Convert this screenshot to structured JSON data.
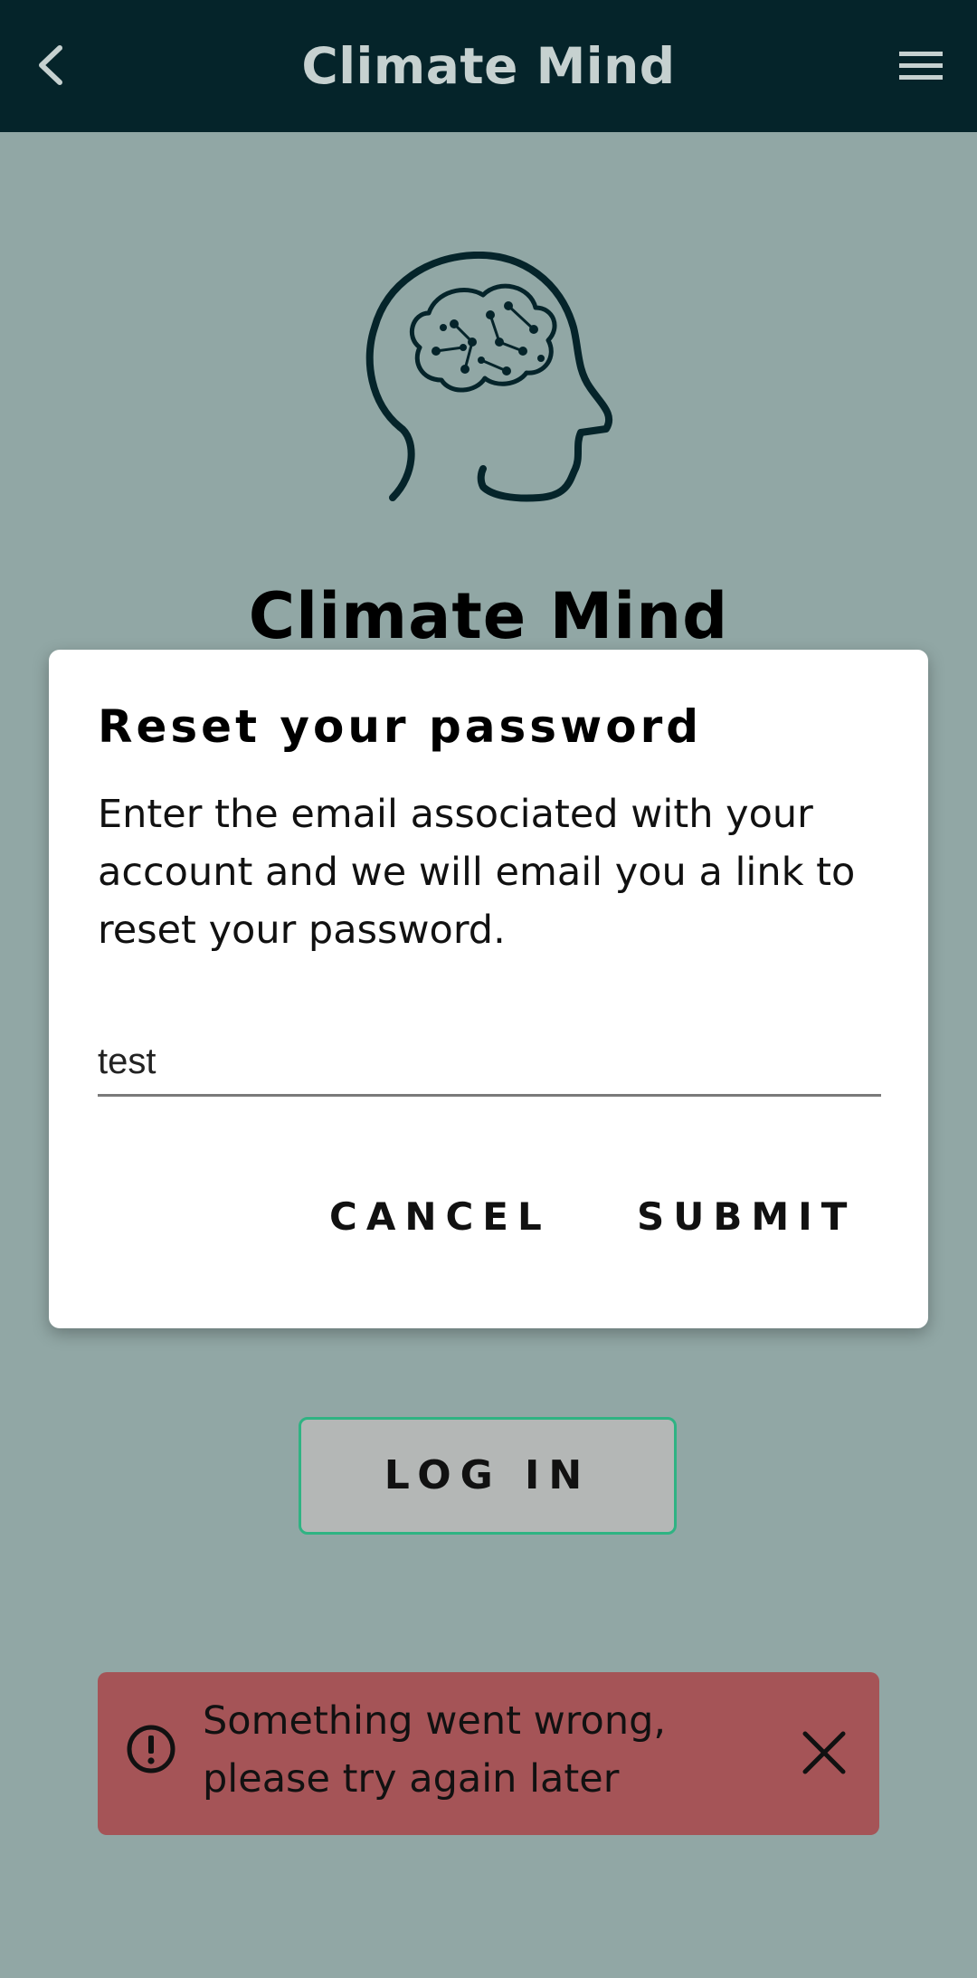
{
  "app_bar": {
    "title": "Climate Mind",
    "back_icon": "chevron-left-icon",
    "menu_icon": "hamburger-menu-icon"
  },
  "logo": {
    "icon": "brain-head-icon"
  },
  "brand": {
    "title": "Climate Mind"
  },
  "dialog": {
    "title": "Reset your password",
    "body": "Enter the email associated with your account and we will email you a link to reset your password.",
    "email_value": "test",
    "cancel_label": "CANCEL",
    "submit_label": "SUBMIT"
  },
  "login": {
    "label": "LOG IN"
  },
  "toast": {
    "icon": "alert-circle-icon",
    "line1": "Something went wrong,",
    "line2": "please try again later",
    "close_icon": "close-icon"
  },
  "colors": {
    "app_bar_bg": "#05242a",
    "page_bg": "#91a7a5",
    "toast_bg": "#a55457",
    "login_border": "#2fb383"
  }
}
